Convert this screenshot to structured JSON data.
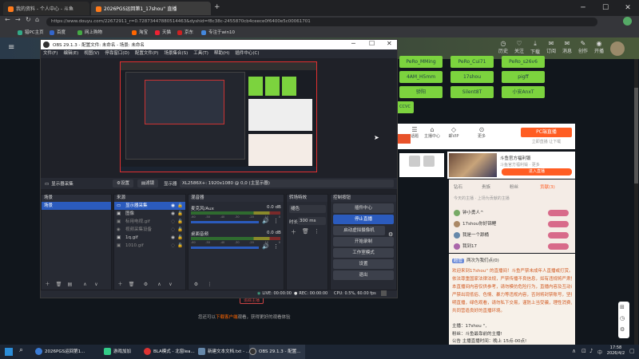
{
  "browser": {
    "tabs": [
      {
        "label": "我的资料 - 个人中心 - 斗鱼"
      },
      {
        "label": "2026PGS运回第1_17shou'' 直播"
      }
    ],
    "url": "https://www.douyu.com/22672911_r=0.72873447880514463&dyshid=f8c38c-2455870cb4ceece0f6400e5c00061701",
    "bookmarks": [
      "猎PC主页",
      "百度",
      "网上购物",
      "淘宝",
      "天猫",
      "京东",
      "专注于win10"
    ]
  },
  "douyu": {
    "nav": [
      "历史",
      "关注",
      "下载",
      "订阅",
      "消息",
      "创作",
      "开播"
    ],
    "pills": [
      "PeRo_MMing",
      "PeRo_Cui71",
      "PeRo_s26v6",
      "4AM_H5mm",
      "17shou",
      "pigff",
      "骄阳",
      "Silent8T",
      "小安AnxT",
      "CCVC"
    ],
    "bottom_text_prefix": "您还可以",
    "bottom_link": "下载客户端",
    "bottom_text_suffix": "观看，获得更好的观看体验",
    "report_btn": "追踪主播",
    "left_tabs": [
      "爱心能力",
      "爬行中心"
    ],
    "middle_icons": [
      "话题",
      "主播中心",
      "邮VIP",
      "更多"
    ],
    "pc_live_btn": "PC端直播",
    "pc_live_sub": "立即直播 让下载",
    "ad_title": "斗鱼官方福利锻",
    "ad_sub": "斗鱼官方福利锻 · 更多",
    "ad_btn": "进入直播",
    "ranking_tabs": [
      "钻石",
      "贵族",
      "粉丝",
      "贡献(3)"
    ],
    "ranking_row_hdr": "今天的主播 · 上场为贡献的主播",
    "ranking_items": [
      "钟小勇人^",
      "17shou你好锦鲤",
      "我是一个舔桶",
      "我到17"
    ],
    "chat_user": "超管",
    "chat_head": "两次为我们点(0)",
    "chat_lines": [
      "欢迎来到17shou'' 的直播间！斗鱼严禁未成年人直播或打赏。",
      "依法尊重国家法律法规，严禁传播不良信息，如有违规将严肃处理，",
      "本直播间内容仅供参考，请勿模仿危险行为，直播内容及互动评论",
      "严禁出现低俗、色情、暴力等违规内容，否则将封禁账号，坚持文",
      "明直播，绿色观看，请勿私下交易，谨防上当受骗，理性消费，",
      "共同营造良好的直播环境。"
    ],
    "host_line_label": "主播：",
    "host_line_val": "17shou '',",
    "fans_line": "粉丝：斗鱼最靠前的主播!",
    "push_line": "公告  主播直播时间：晚上 15点-00点!",
    "input_placeholder": "发个弹幕呗"
  },
  "obs": {
    "title": "OBS 29.1.3 - 配置文件: 未命名 - 场景: 未命名",
    "menu": [
      "文件(F)",
      "编辑(E)",
      "视图(V)",
      "停靠窗口(D)",
      "配置文件(P)",
      "场景集合(S)",
      "工具(T)",
      "帮助(H)",
      "插件中心(C)"
    ],
    "source_bar": {
      "source_label": "显示器采集",
      "settings_btn": "设置",
      "filters_btn": "滤镜",
      "display_label": "显示器",
      "display_value": "XL2586X+: 1920x1080 @ 0,0 (主显示器)"
    },
    "docks": {
      "scenes": {
        "title": "场景",
        "items": [
          "场景"
        ]
      },
      "sources": {
        "title": "来源",
        "items": [
          "显示器采集",
          "图像",
          "标用电视.gif",
          "视频采集设备",
          "1q.gif",
          "1010.gif"
        ]
      },
      "mixer": {
        "title": "混音器",
        "channels": [
          {
            "name": "麦克风/Aux",
            "db": "0.0 dB"
          },
          {
            "name": "桌面音频",
            "db": "0.0 dB"
          }
        ],
        "scale": [
          "-60",
          "-55",
          "-50",
          "-45",
          "-40",
          "-35",
          "-30",
          "-25",
          "-20",
          "-15",
          "-10",
          "-5",
          "0"
        ]
      },
      "transitions": {
        "title": "转场特效",
        "type": "褪色",
        "duration_label": "时长",
        "duration_value": "300 ms"
      },
      "controls": {
        "title": "控制按钮",
        "buttons": [
          "插件中心",
          "停止直播",
          "启动虚拟摄像机",
          "开始录制",
          "工作室模式",
          "设置",
          "退出"
        ]
      }
    },
    "status": {
      "live": "LIVE: 00:00:00",
      "rec": "REC: 00:00:00",
      "cpu": "CPU: 0.5%, 60.00 fps"
    }
  },
  "taskbar": {
    "items": [
      "2026PGS运回第1...",
      "游戏加加",
      "BLA模式 - 北窗lea...",
      "新建文本文档.txt - ...",
      "OBS 29.1.3 - 配置..."
    ],
    "time": "17:58",
    "date": "2026/4/2",
    "lang": "中"
  },
  "colors": {
    "obs_bg": "#1f2128",
    "obs_accent": "#2b5bbd",
    "pill_green": "#7cd33e",
    "douyu_orange": "#ff5d23"
  }
}
